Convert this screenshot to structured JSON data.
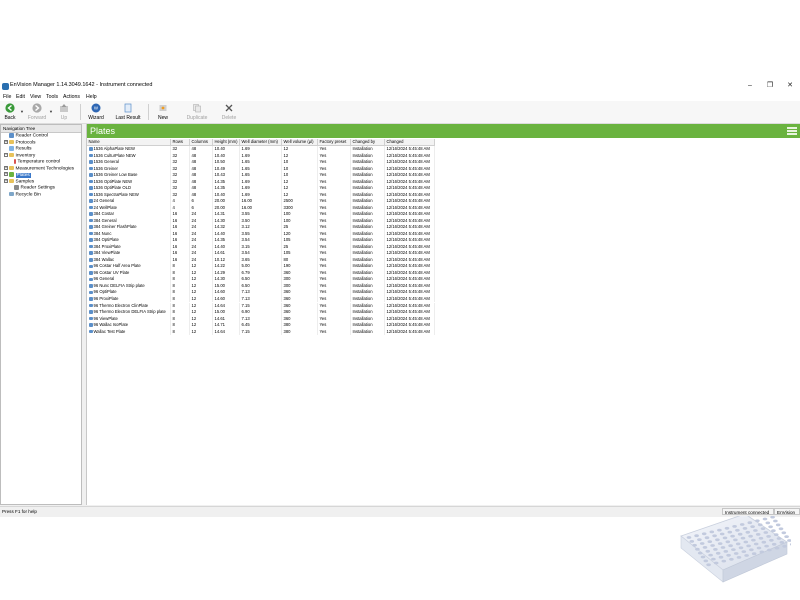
{
  "window": {
    "title": "EnVision Manager 1.14.3049.1642 - Instrument connected",
    "controls": {
      "minimize": "–",
      "maximize": "❐",
      "close": "✕"
    }
  },
  "menu": [
    "File",
    "Edit",
    "View",
    "Tools",
    "Actions",
    "Help"
  ],
  "toolbar": {
    "back": "Back",
    "forward": "Forward",
    "up": "Up",
    "wizard": "Wizard",
    "last_result": "Last Result",
    "new": "New",
    "duplicate": "Duplicate",
    "delete": "Delete"
  },
  "nav": {
    "header": "Navigation Tree",
    "items": [
      {
        "label": "Reader Control",
        "icon": "reader-icon"
      },
      {
        "label": "Protocols",
        "icon": "folder-icon"
      },
      {
        "label": "Results",
        "icon": "results-icon"
      },
      {
        "label": "Inventory",
        "icon": "folder-icon"
      },
      {
        "label": "Temperature control",
        "icon": "thermometer-icon"
      },
      {
        "label": "Measurement Technologies",
        "icon": "folder-icon"
      },
      {
        "label": "Plates",
        "icon": "plate-icon"
      },
      {
        "label": "Samples",
        "icon": "folder-icon"
      },
      {
        "label": "Reader Settings",
        "icon": "settings-icon"
      },
      {
        "label": "Recycle Bin",
        "icon": "recycle-bin-icon"
      }
    ]
  },
  "panel": {
    "title": "Plates",
    "columns": [
      "Name",
      "Rows",
      "Columns",
      "Height (mm)",
      "Well diameter (mm)",
      "Well volume (µl)",
      "Factory preset",
      "Changed by",
      "Changed"
    ],
    "rows": [
      [
        "1536 AlphaPlate NEW",
        "32",
        "48",
        "10.40",
        "1.69",
        "12",
        "Yes",
        "Installation",
        "12/16/2024 5:45:48 AM"
      ],
      [
        "1536 CulturPlate NEW",
        "32",
        "48",
        "10.40",
        "1.69",
        "12",
        "Yes",
        "Installation",
        "12/16/2024 5:45:48 AM"
      ],
      [
        "1536 General",
        "32",
        "48",
        "10.50",
        "1.65",
        "10",
        "Yes",
        "Installation",
        "12/16/2024 5:45:48 AM"
      ],
      [
        "1536 Greiner",
        "32",
        "48",
        "10.49",
        "1.65",
        "10",
        "Yes",
        "Installation",
        "12/16/2024 5:45:48 AM"
      ],
      [
        "1536 Greiner Low Base",
        "32",
        "48",
        "10.43",
        "1.65",
        "10",
        "Yes",
        "Installation",
        "12/16/2024 5:45:48 AM"
      ],
      [
        "1536 OptiPlate NEW",
        "32",
        "48",
        "14.35",
        "1.69",
        "12",
        "Yes",
        "Installation",
        "12/16/2024 5:45:48 AM"
      ],
      [
        "1536 OptiPlate OLD",
        "32",
        "48",
        "14.35",
        "1.69",
        "12",
        "Yes",
        "Installation",
        "12/16/2024 5:45:48 AM"
      ],
      [
        "1536 SpectraPlate NEW",
        "32",
        "48",
        "10.40",
        "1.69",
        "12",
        "Yes",
        "Installation",
        "12/16/2024 5:45:48 AM"
      ],
      [
        "24 General",
        "4",
        "6",
        "20.00",
        "16.00",
        "2500",
        "Yes",
        "Installation",
        "12/16/2024 5:45:48 AM"
      ],
      [
        "24 WellPlate",
        "4",
        "6",
        "20.00",
        "16.00",
        "3300",
        "Yes",
        "Installation",
        "12/16/2024 5:45:48 AM"
      ],
      [
        "384 Costar",
        "16",
        "24",
        "14.31",
        "3.55",
        "100",
        "Yes",
        "Installation",
        "12/16/2024 5:45:48 AM"
      ],
      [
        "384 General",
        "16",
        "24",
        "14.30",
        "3.50",
        "100",
        "Yes",
        "Installation",
        "12/16/2024 5:45:48 AM"
      ],
      [
        "384 Greiner FlashPlate",
        "16",
        "24",
        "14.32",
        "3.12",
        "25",
        "Yes",
        "Installation",
        "12/16/2024 5:45:48 AM"
      ],
      [
        "384 Nunc",
        "16",
        "24",
        "14.40",
        "3.55",
        "120",
        "Yes",
        "Installation",
        "12/16/2024 5:45:48 AM"
      ],
      [
        "384 OptiPlate",
        "16",
        "24",
        "14.35",
        "3.54",
        "105",
        "Yes",
        "Installation",
        "12/16/2024 5:45:48 AM"
      ],
      [
        "384 ProxiPlate",
        "16",
        "24",
        "14.40",
        "3.15",
        "25",
        "Yes",
        "Installation",
        "12/16/2024 5:45:48 AM"
      ],
      [
        "384 ViewPlate",
        "16",
        "24",
        "14.61",
        "3.54",
        "105",
        "Yes",
        "Installation",
        "12/16/2024 5:45:48 AM"
      ],
      [
        "384 Wallac",
        "16",
        "24",
        "10.12",
        "3.65",
        "80",
        "Yes",
        "Installation",
        "12/16/2024 5:45:48 AM"
      ],
      [
        "96 Costar Half Area Plate",
        "8",
        "12",
        "14.22",
        "5.00",
        "190",
        "Yes",
        "Installation",
        "12/16/2024 5:45:48 AM"
      ],
      [
        "96 Costar UV Plate",
        "8",
        "12",
        "14.29",
        "6.79",
        "360",
        "Yes",
        "Installation",
        "12/16/2024 5:45:48 AM"
      ],
      [
        "96 General",
        "8",
        "12",
        "14.30",
        "6.50",
        "300",
        "Yes",
        "Installation",
        "12/16/2024 5:45:48 AM"
      ],
      [
        "96 Nunc DELFIA Strip plate",
        "8",
        "12",
        "15.00",
        "6.50",
        "300",
        "Yes",
        "Installation",
        "12/16/2024 5:45:48 AM"
      ],
      [
        "96 OptiPlate",
        "8",
        "12",
        "14.60",
        "7.13",
        "360",
        "Yes",
        "Installation",
        "12/16/2024 5:45:48 AM"
      ],
      [
        "96 ProxiPlate",
        "8",
        "12",
        "14.60",
        "7.13",
        "360",
        "Yes",
        "Installation",
        "12/16/2024 5:45:48 AM"
      ],
      [
        "96 Thermo Electron ClinPlate",
        "8",
        "12",
        "14.64",
        "7.15",
        "360",
        "Yes",
        "Installation",
        "12/16/2024 5:45:48 AM"
      ],
      [
        "96 Thermo Electron DELFIA Strip plate",
        "8",
        "12",
        "15.00",
        "6.90",
        "360",
        "Yes",
        "Installation",
        "12/16/2024 5:45:48 AM"
      ],
      [
        "96 ViewPlate",
        "8",
        "12",
        "14.61",
        "7.13",
        "360",
        "Yes",
        "Installation",
        "12/16/2024 5:45:48 AM"
      ],
      [
        "96 Wallac IsoPlate",
        "8",
        "12",
        "14.71",
        "6.45",
        "380",
        "Yes",
        "Installation",
        "12/16/2024 5:45:48 AM"
      ],
      [
        "Wallac Test Plate",
        "8",
        "12",
        "14.64",
        "7.15",
        "380",
        "Yes",
        "Installation",
        "12/16/2024 5:45:48 AM"
      ]
    ]
  },
  "status": {
    "help": "Press F1 for help",
    "connection": "Instrument connected",
    "app": "EnVision"
  },
  "colors": {
    "header_green": "#6ab33f",
    "selection_blue": "#3a78c9"
  }
}
